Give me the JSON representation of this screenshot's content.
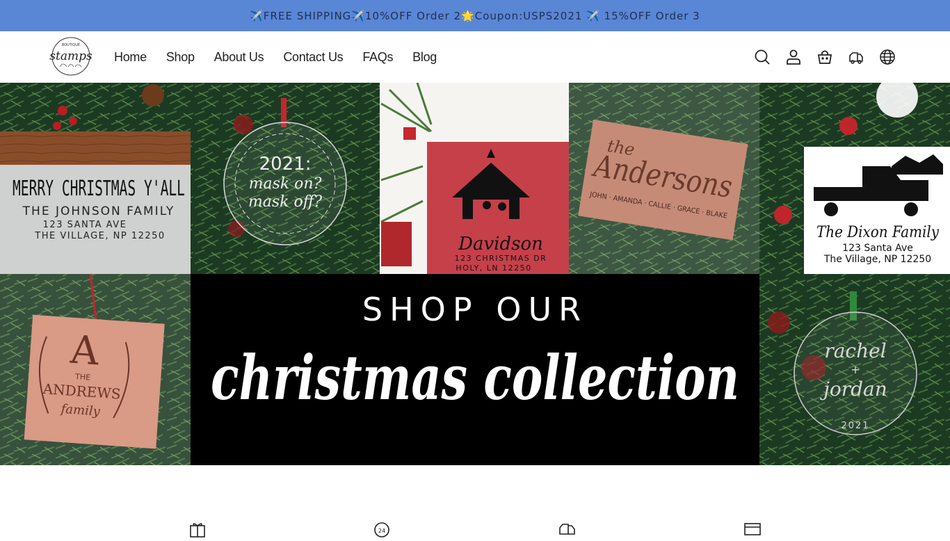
{
  "announcement": {
    "text": "✈️FREE SHIPPING✈️10%OFF Order 2🌟Coupon:USPS2021 ✈️ 15%OFF Order 3"
  },
  "brand": {
    "logo_top": "BOUTIQUE",
    "logo_main": "stamps",
    "logo_alt": "Boutique Stamps"
  },
  "nav": {
    "items": [
      "Home",
      "Shop",
      "About Us",
      "Contact Us",
      "FAQs",
      "Blog"
    ]
  },
  "header_icons": [
    "search-icon",
    "account-icon",
    "cart-icon",
    "shipping-truck-icon",
    "globe-icon"
  ],
  "hero": {
    "tiles": {
      "merry": {
        "line1": "MERRY CHRISTMAS Y'ALL",
        "line2": "THE JOHNSON FAMILY",
        "line3": "123 SANTA AVE",
        "line4": "THE VILLAGE, NP 12250"
      },
      "mask": {
        "line1": "2021:",
        "line2": "mask on?",
        "line3": "mask off?"
      },
      "davidson": {
        "name": "Davidson",
        "line1": "123 CHRISTMAS DR",
        "line2": "HOLY, LN 12250"
      },
      "andersons": {
        "the": "the",
        "name": "Andersons",
        "members": "JOHN · AMANDA · CALLIE · GRACE · BLAKE"
      },
      "dixon": {
        "name": "The Dixon Family",
        "line1": "123 Santa Ave",
        "line2": "The Village, NP 12250"
      },
      "andrews": {
        "initial": "A",
        "the": "THE",
        "name": "ANDREWS",
        "family": "family"
      },
      "banner": {
        "top": "SHOP OUR",
        "script": "christmas collection"
      },
      "rachel": {
        "line1": "rachel",
        "line2": "+",
        "line3": "jordan",
        "year": "2021"
      }
    }
  },
  "feature_icons": [
    "gift-box-icon",
    "support-24-icon",
    "shipping-truck-icon",
    "payment-card-icon"
  ],
  "colors": {
    "announcement_bg": "#5a86d6",
    "banner_bg": "#000000",
    "stamp_red": "#c6404a"
  }
}
